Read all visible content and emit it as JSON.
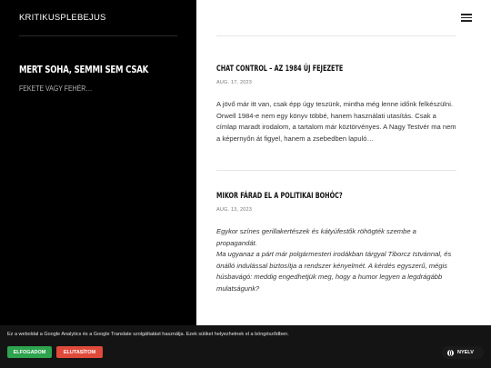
{
  "sidebar": {
    "site_title": "KRITIKUSPLEBEJUS",
    "tagline": "MERT SOHA, SEMMI SEM CSAK",
    "subtagline": "FEKETE VAGY FEHÉR…"
  },
  "posts": [
    {
      "title": "Chat Control – az 1984 új fejezete",
      "date": "AUG. 17, 2023",
      "excerpt": "A jövő már itt van, csak épp úgy teszünk, mintha még lenne időnk felkészülni. Orwell 1984-e nem egy könyv többé, hanem használati utasítás. Csak a címlap maradt irodalom, a tartalom már köztörvényes. A Nagy Testvér ma nem a képernyőn át figyel, hanem a zsebedben lapuló…"
    },
    {
      "title": "Mikor fárad el a politikai bohóc?",
      "date": "AUG. 13, 2023",
      "excerpt_lines": [
        "Egykor színes gerillakertészek és kátyúfestők röhögték szembe a propagandát.",
        "Ma ugyanaz a párt már polgármesteri irodákban tárgyal Tiborcz Istvánnal, és önálló indulással biztosítja a rendszer kényelmét. A kérdés egyszerű, mégis húsbavágó: meddig engedhetjük meg, hogy a humor legyen a legdrágább mulatságunk?"
      ]
    }
  ],
  "cookie": {
    "text": "Ez a weboldal a Google Analytics és a Google Translate szolgáltatást használja. Ezek sütiket helyezhetnek el a böngésződben.",
    "accept_label": "ELFOGADOM",
    "reject_label": "ELUTASÍTOM"
  },
  "language": {
    "label": "NYELV"
  },
  "icons": {
    "menu": "hamburger-menu-icon",
    "language": "globe-icon"
  },
  "colors": {
    "sidebar_bg": "#000000",
    "accept": "#2ea44f",
    "reject": "#e04a3b"
  }
}
